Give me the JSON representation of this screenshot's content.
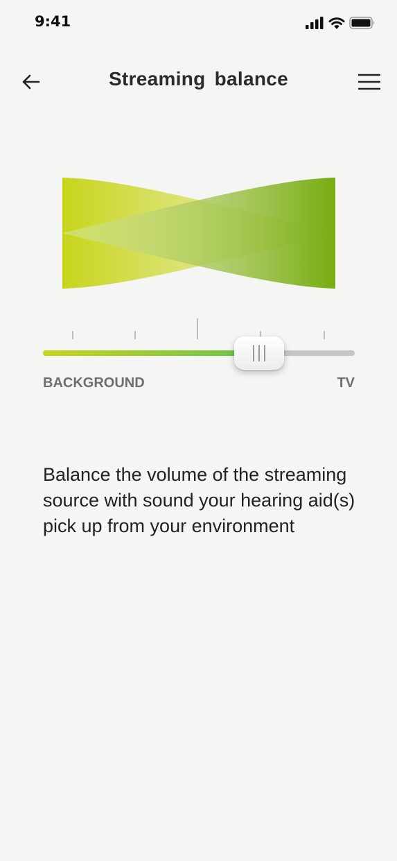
{
  "status_bar": {
    "time": "9:41",
    "icons": [
      "signal-icon",
      "wifi-icon",
      "battery-icon"
    ]
  },
  "header": {
    "title": "Streaming  balance",
    "back_icon": "arrow-left-icon",
    "menu_icon": "hamburger-menu-icon"
  },
  "balance": {
    "value_fraction": 0.7,
    "left_label": "BACKGROUND",
    "right_label": "TV",
    "tick_count": 5,
    "colors": {
      "left": "#c8d51a",
      "right": "#7aae0f",
      "track": "#c6c6c6",
      "fill_end": "#6cc24a"
    }
  },
  "description": "Balance the volume of the streaming source with sound your hearing aid(s) pick up from your environment"
}
